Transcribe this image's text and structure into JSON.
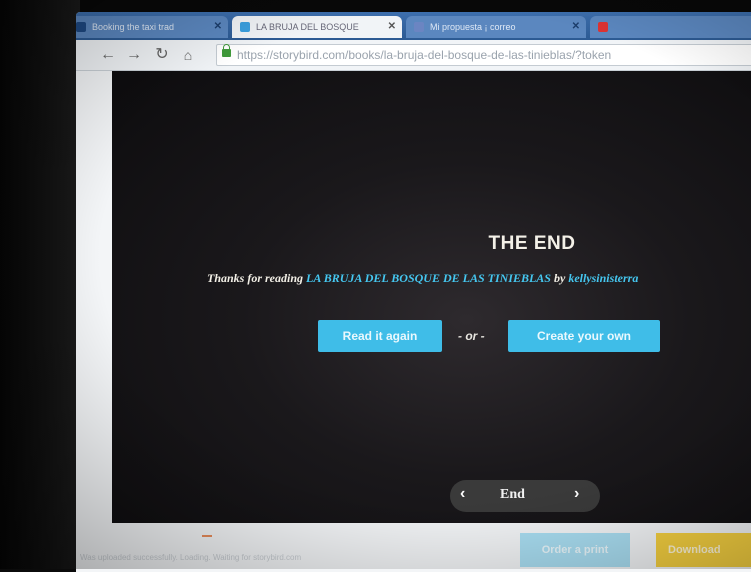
{
  "browser": {
    "tabs": [
      {
        "title": "Booking the taxi trad",
        "color": "#2c5a93"
      },
      {
        "title": "LA BRUJA DEL BOSQUE",
        "color": "#3aa0e0",
        "active": true
      },
      {
        "title": "Mi propuesta ¡ correo",
        "color": "#6b85c2"
      },
      {
        "title": "",
        "color": "#d33"
      }
    ],
    "url": "https://storybird.com/books/la-bruja-del-bosque-de-las-tinieblas/?token"
  },
  "icons": {
    "back": "back-arrow-icon",
    "forward": "forward-arrow-icon",
    "reload": "reload-icon",
    "home": "home-icon",
    "lock": "lock-icon"
  },
  "book": {
    "end_title": "THE END",
    "thanks_prefix": "Thanks for reading",
    "book_title": "LA BRUJA DEL BOSQUE DE LAS TINIEBLAS",
    "by": "by",
    "author": "kellysinisterra",
    "read_again": "Read it again",
    "or": "- or -",
    "create_own": "Create your own",
    "pager_label": "End",
    "prev_glyph": "‹",
    "next_glyph": "›"
  },
  "footer": {
    "status": "Was uploaded successfully. Loading. Waiting for storybird.com",
    "order_print": "Order a print",
    "download": "Download"
  },
  "colors": {
    "accent_blue": "#3fbde8",
    "download_yellow": "#f5d040",
    "link_cyan": "#45c7f0"
  }
}
